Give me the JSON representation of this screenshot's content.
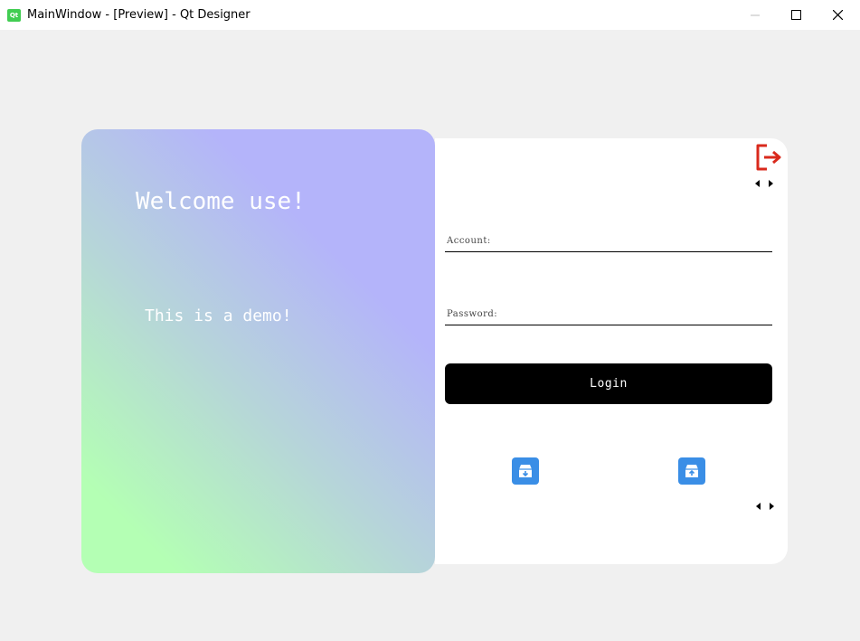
{
  "window": {
    "title": "MainWindow - [Preview] - Qt Designer",
    "app_icon_text": "Qt"
  },
  "left_panel": {
    "welcome": "Welcome use!",
    "subtitle": "This is a demo!"
  },
  "form": {
    "account_placeholder": "Account:",
    "password_placeholder": "Password:",
    "login_label": "Login"
  },
  "icons": {
    "exit": "exit-icon",
    "download": "archive-download-icon",
    "upload": "archive-upload-icon"
  },
  "colors": {
    "exit_icon": "#d9291c",
    "icon_button": "#3a8ee6",
    "login_button": "#000000",
    "gradient_green": "#b4ffb4",
    "gradient_purple": "#b4b4fa"
  }
}
